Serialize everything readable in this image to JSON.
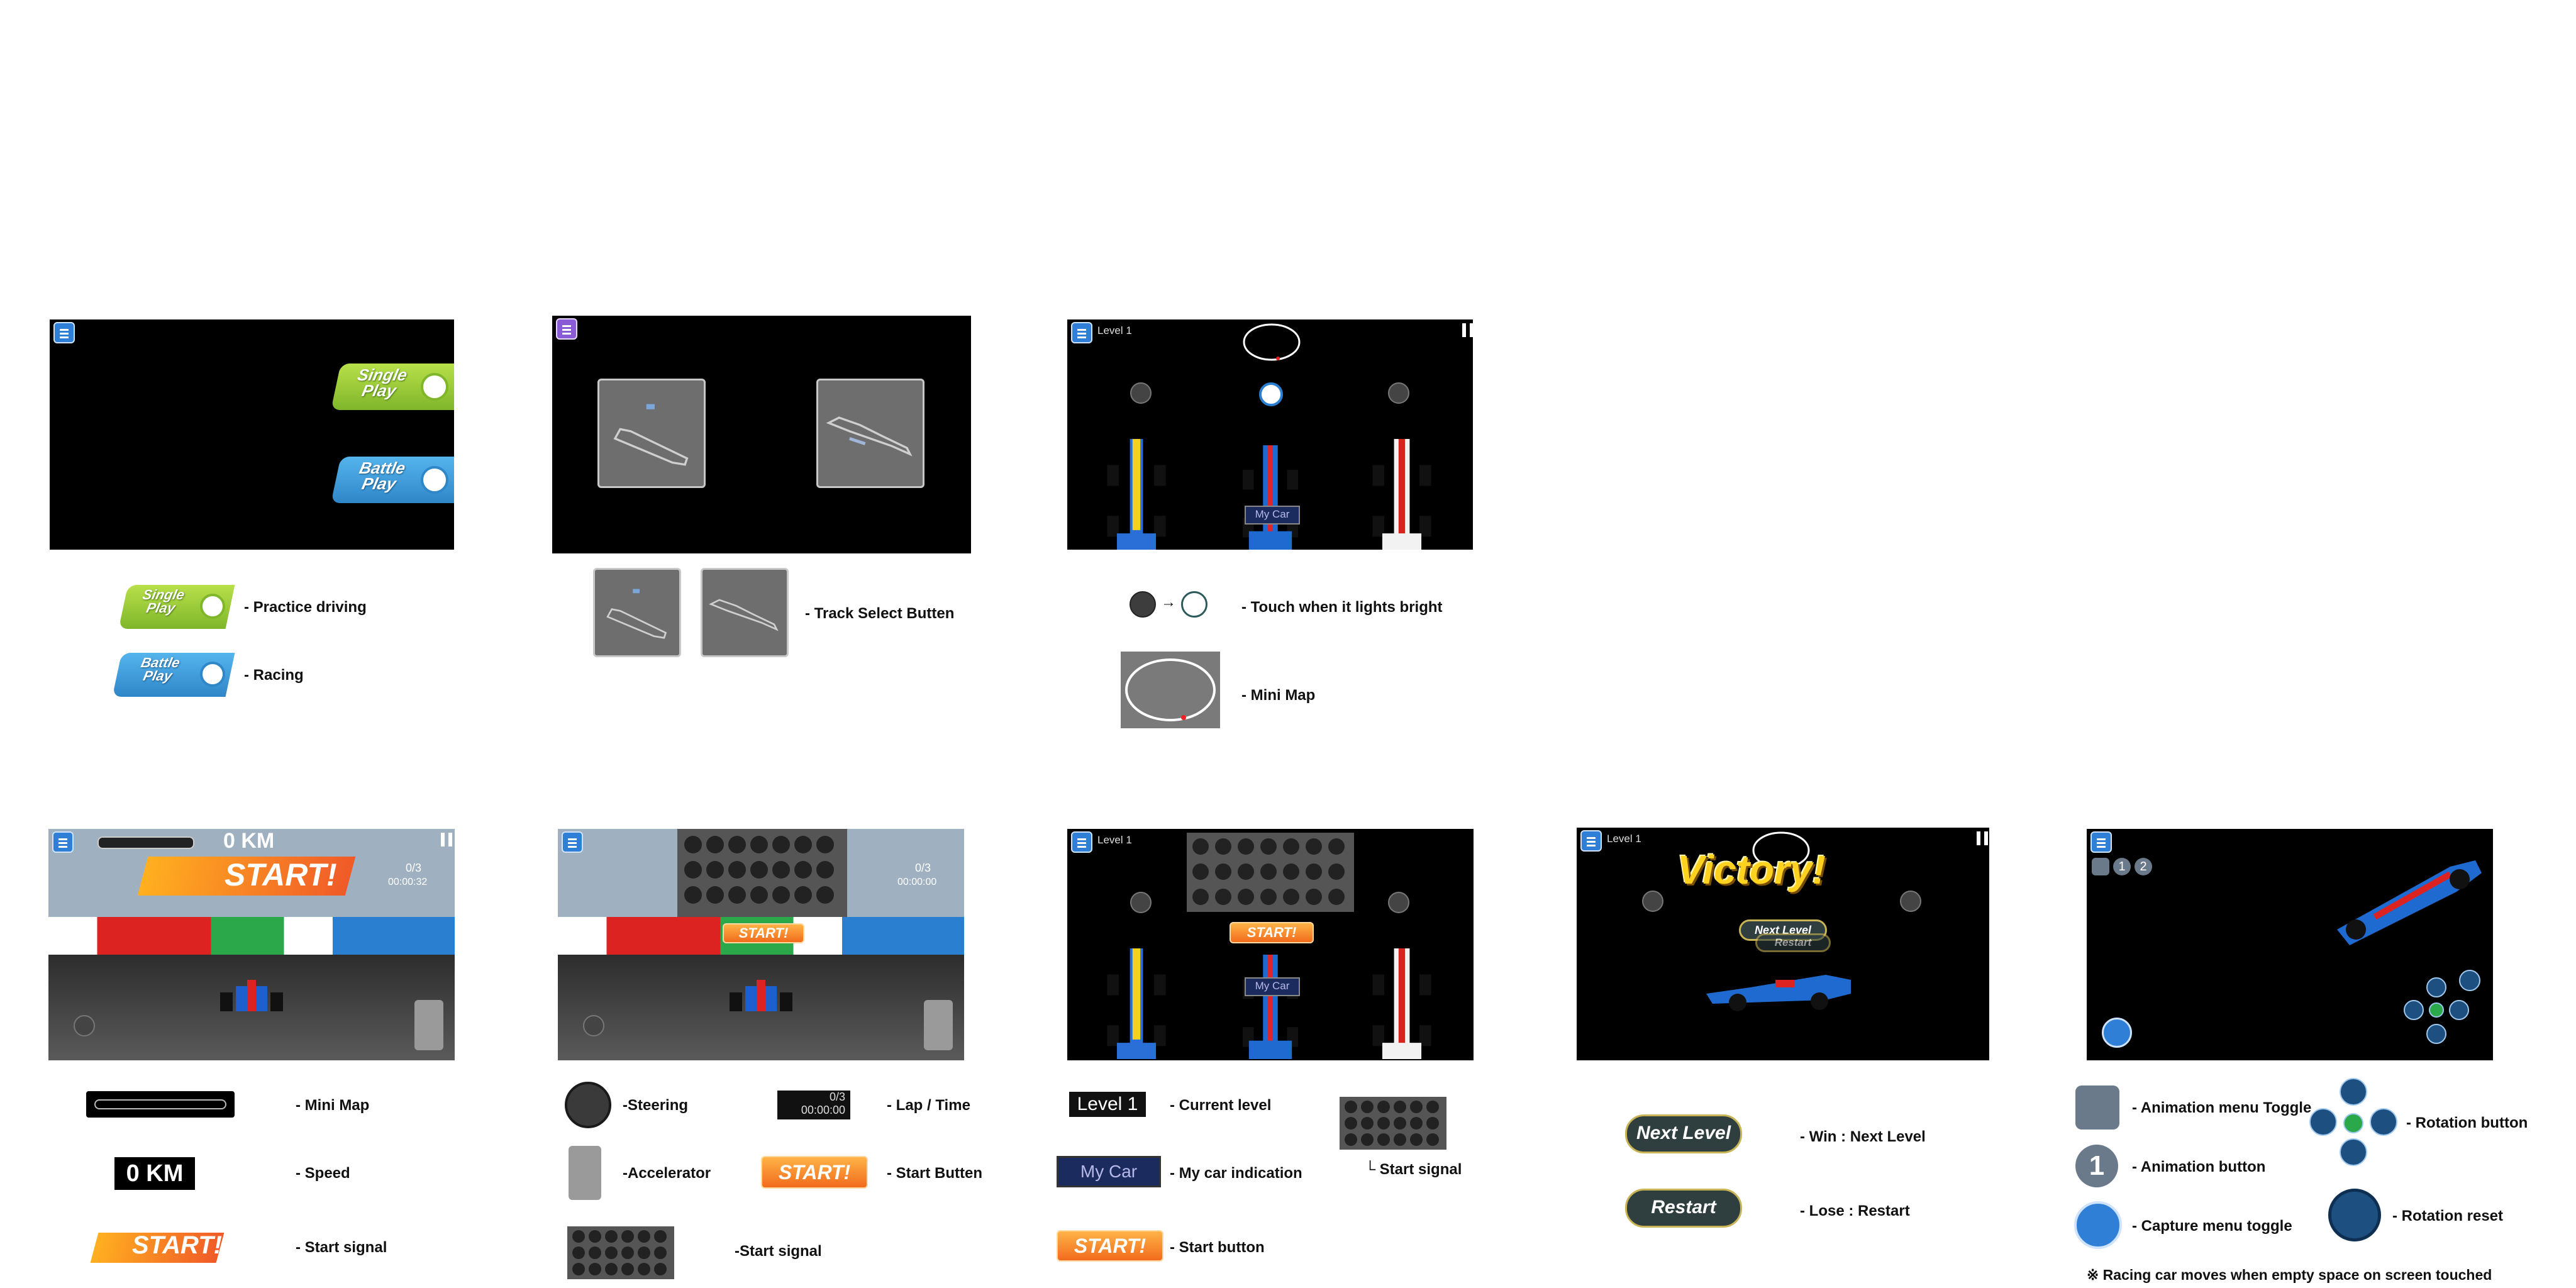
{
  "panel1": {
    "single_play_1": "Single",
    "single_play_2": "Play",
    "battle_play_1": "Battle",
    "battle_play_2": "Play",
    "legend_single_1": "Single",
    "legend_single_2": "Play",
    "legend_single_desc": "- Practice driving",
    "legend_battle_1": "Battle",
    "legend_battle_2": "Play",
    "legend_battle_desc": "- Racing"
  },
  "panel2": {
    "track_select_desc": "- Track Select Butten"
  },
  "panel3": {
    "level": "Level 1",
    "my_car": "My Car",
    "touch_desc": "- Touch when it lights bright",
    "arrow": "→",
    "minimap_desc": "- Mini Map"
  },
  "panel4": {
    "speed": "0 KM",
    "start_text": "START!",
    "lap": "0/3",
    "time": "00:00:32",
    "minimap_desc": "- Mini Map",
    "speed_badge": "0 KM",
    "speed_desc": "- Speed",
    "start_badge": "START!",
    "start_desc": "- Start signal"
  },
  "panel5": {
    "lap": "0/3",
    "time": "00:00:00",
    "start_text": "START!",
    "steering_desc": "-Steering",
    "lap_badge": "0/3",
    "lap_time_badge": "00:00:00",
    "lap_desc": "- Lap / Time",
    "accel_desc": "-Accelerator",
    "start_badge": "START!",
    "start_button_desc": "- Start Butten",
    "start_signal_desc": "-Start signal"
  },
  "panel6": {
    "level": "Level 1",
    "start_text": "START!",
    "my_car": "My Car",
    "level_badge": "Level 1",
    "level_desc": "- Current level",
    "my_car_badge": "My Car",
    "my_car_desc": "- My car indication",
    "start_badge": "START!",
    "start_button_desc": "- Start button",
    "start_signal_desc": "└ Start signal"
  },
  "panel7": {
    "level": "Level 1",
    "victory": "Victory!",
    "next_level": "Next Level",
    "restart": "Restart",
    "next_level_badge": "Next Level",
    "next_level_desc": "- Win : Next Level",
    "restart_badge": "Restart",
    "restart_desc": "-  Lose : Restart"
  },
  "panel8": {
    "anim1": "1",
    "anim2": "2",
    "anim_toggle_desc": "- Animation menu Toggle",
    "anim_button_num": "1",
    "anim_button_desc": "- Animation button",
    "capture_desc": "- Capture menu toggle",
    "rotation_desc": "- Rotation button",
    "rotation_reset_desc": "- Rotation reset",
    "note": "※ Racing car moves when empty space on screen touched"
  },
  "colors": {
    "accent_blue": "#2f7fd6",
    "green": "#8cc63f",
    "orange": "#f26b1d",
    "gold": "#ffd21f"
  }
}
